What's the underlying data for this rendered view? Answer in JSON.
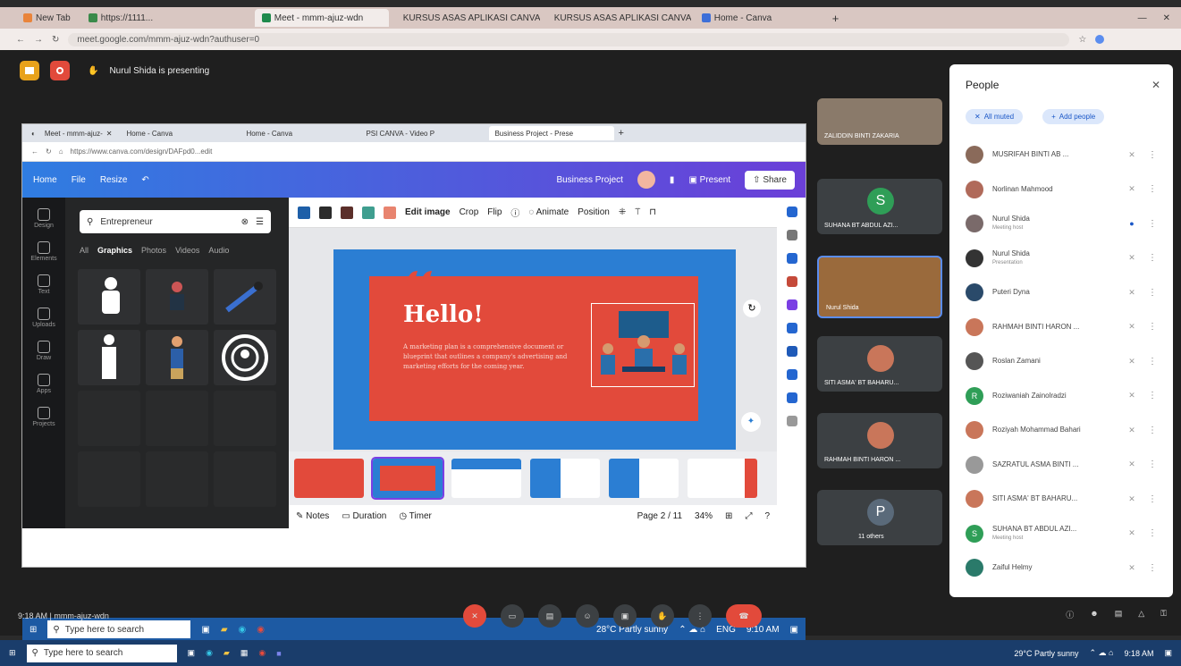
{
  "outer_browser": {
    "tabs": [
      {
        "label": "New Tab"
      },
      {
        "label": "https://1111..."
      },
      {
        "label": "Meet - mmm-ajuz-wdn"
      },
      {
        "label": "KURSUS ASAS APLIKASI CANVA"
      },
      {
        "label": "KURSUS ASAS APLIKASI CANVA"
      },
      {
        "label": "Home - Canva"
      }
    ],
    "url": "meet.google.com/mmm-ajuz-wdn?authuser=0"
  },
  "meet": {
    "presenting_text": "Nurul Shida is presenting",
    "time_code": "9:18 AM  |  mmm-ajuz-wdn"
  },
  "shared_window": {
    "tabs": [
      {
        "label": "Meet - mmm-ajuz-"
      },
      {
        "label": "Home - Canva"
      },
      {
        "label": "Home - Canva"
      },
      {
        "label": "PSI CANVA - Video P"
      },
      {
        "label": "Business Project - Prese"
      }
    ],
    "url": "https://www.canva.com/design/DAFpd0...edit",
    "canva_top": {
      "home": "Home",
      "file": "File",
      "resize": "Resize",
      "project_name": "Business Project",
      "present": "Present",
      "share": "Share"
    },
    "rail": [
      "Design",
      "Elements",
      "Text",
      "Uploads",
      "Draw",
      "Apps",
      "Projects"
    ],
    "search": {
      "value": "Entrepreneur"
    },
    "side_tabs": [
      "All",
      "Graphics",
      "Photos",
      "Videos",
      "Audio"
    ],
    "editbar": {
      "swatches": [
        "#1e5fa8",
        "#2b2b2b",
        "#5b2f2a",
        "#3f9e8f",
        "#e8846f"
      ],
      "edit_image": "Edit image",
      "crop": "Crop",
      "flip": "Flip",
      "animate": "Animate",
      "position": "Position"
    },
    "slide": {
      "heading": "Hello!",
      "body": "A marketing plan is a comprehensive document or blueprint that outlines a company's advertising and marketing efforts for the coming year."
    },
    "bottom": {
      "notes": "Notes",
      "duration": "Duration",
      "timer": "Timer",
      "page": "Page 2 / 11",
      "zoom": "34%"
    },
    "taskbar": {
      "search_placeholder": "Type here to search",
      "weather": "28°C  Partly sunny",
      "lang": "ENG",
      "clock": "9:10 AM"
    }
  },
  "tiles": [
    {
      "name": "ZALIDDIN BINTI ZAKARIA"
    },
    {
      "name": "SUHANA BT ABDUL AZI...",
      "initial": "S"
    },
    {
      "name": "Nurul Shida"
    },
    {
      "name": "SITI ASMA' BT BAHARU..."
    },
    {
      "name": "RAHMAH BINTI HARON ..."
    },
    {
      "name": "11 others",
      "initial": "P"
    }
  ],
  "people_panel": {
    "title": "People",
    "mute_all": "All muted",
    "add_people": "Add people",
    "participants": [
      {
        "name": "MUSRIFAH BINTI AB ..."
      },
      {
        "name": "Norlinan Mahmood"
      },
      {
        "name": "Nurul Shida",
        "sub": "Meeting host"
      },
      {
        "name": "Nurul Shida",
        "sub": "Presentation"
      },
      {
        "name": "Puteri Dyna"
      },
      {
        "name": "RAHMAH BINTI HARON ..."
      },
      {
        "name": "Roslan Zamani"
      },
      {
        "name": "Roziwaniah Zainolradzi"
      },
      {
        "name": "Roziyah Mohammad Bahari"
      },
      {
        "name": "SAZRATUL ASMA BINTI ..."
      },
      {
        "name": "SITI ASMA' BT BAHARU..."
      },
      {
        "name": "SUHANA BT ABDUL AZI...",
        "sub": "Meeting host"
      },
      {
        "name": "Zaiful Helmy"
      }
    ]
  },
  "host_taskbar": {
    "search_placeholder": "Type here to search",
    "weather": "29°C  Partly sunny",
    "clock": "9:18 AM"
  }
}
